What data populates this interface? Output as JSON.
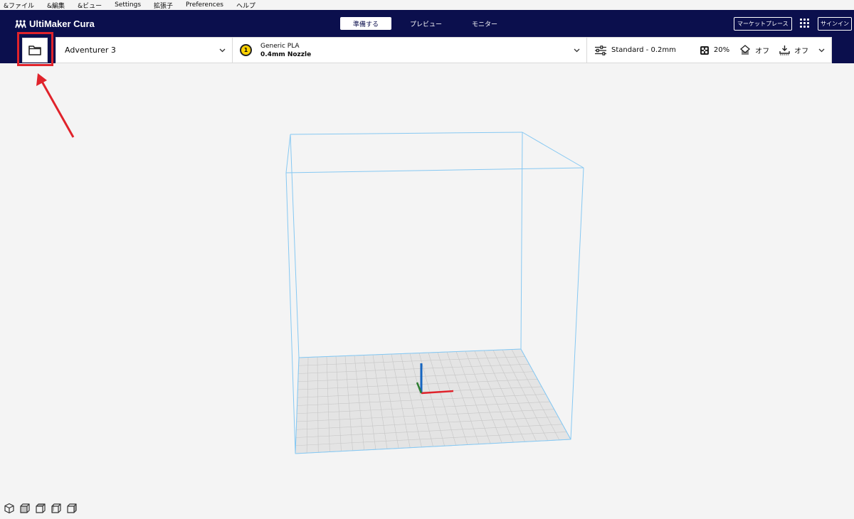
{
  "menubar": {
    "items": [
      "&ファイル",
      "&編集",
      "&ビュー",
      "Settings",
      "拡張子",
      "Preferences",
      "ヘルプ"
    ]
  },
  "header": {
    "brand": "UltiMaker Cura",
    "tabs": [
      {
        "label": "準備する",
        "active": true
      },
      {
        "label": "プレビュー",
        "active": false
      },
      {
        "label": "モニター",
        "active": false
      }
    ],
    "marketplace_label": "マーケットプレース",
    "signin_label": "サインイン"
  },
  "toolbar": {
    "printer": "Adventurer 3",
    "extruder_number": "1",
    "material": "Generic PLA",
    "nozzle": "0.4mm Nozzle",
    "profile": "Standard - 0.2mm",
    "infill": "20%",
    "support": "オフ",
    "adhesion": "オフ"
  },
  "colors": {
    "header_bg": "#0b0f4d",
    "highlight": "#e0232b",
    "build_volume_line": "#7ec3f0",
    "extruder_yellow": "#fdd100",
    "axis_x": "#e0232b",
    "axis_y": "#1565c0",
    "axis_z": "#2e7d32"
  },
  "icons": {
    "open_file": "folder-icon",
    "profile": "sliders-icon",
    "infill": "infill-icon",
    "support": "support-icon",
    "adhesion": "adhesion-icon",
    "views": [
      "3d-view-icon",
      "front-view-icon",
      "top-view-icon",
      "left-view-icon",
      "right-view-icon"
    ]
  }
}
